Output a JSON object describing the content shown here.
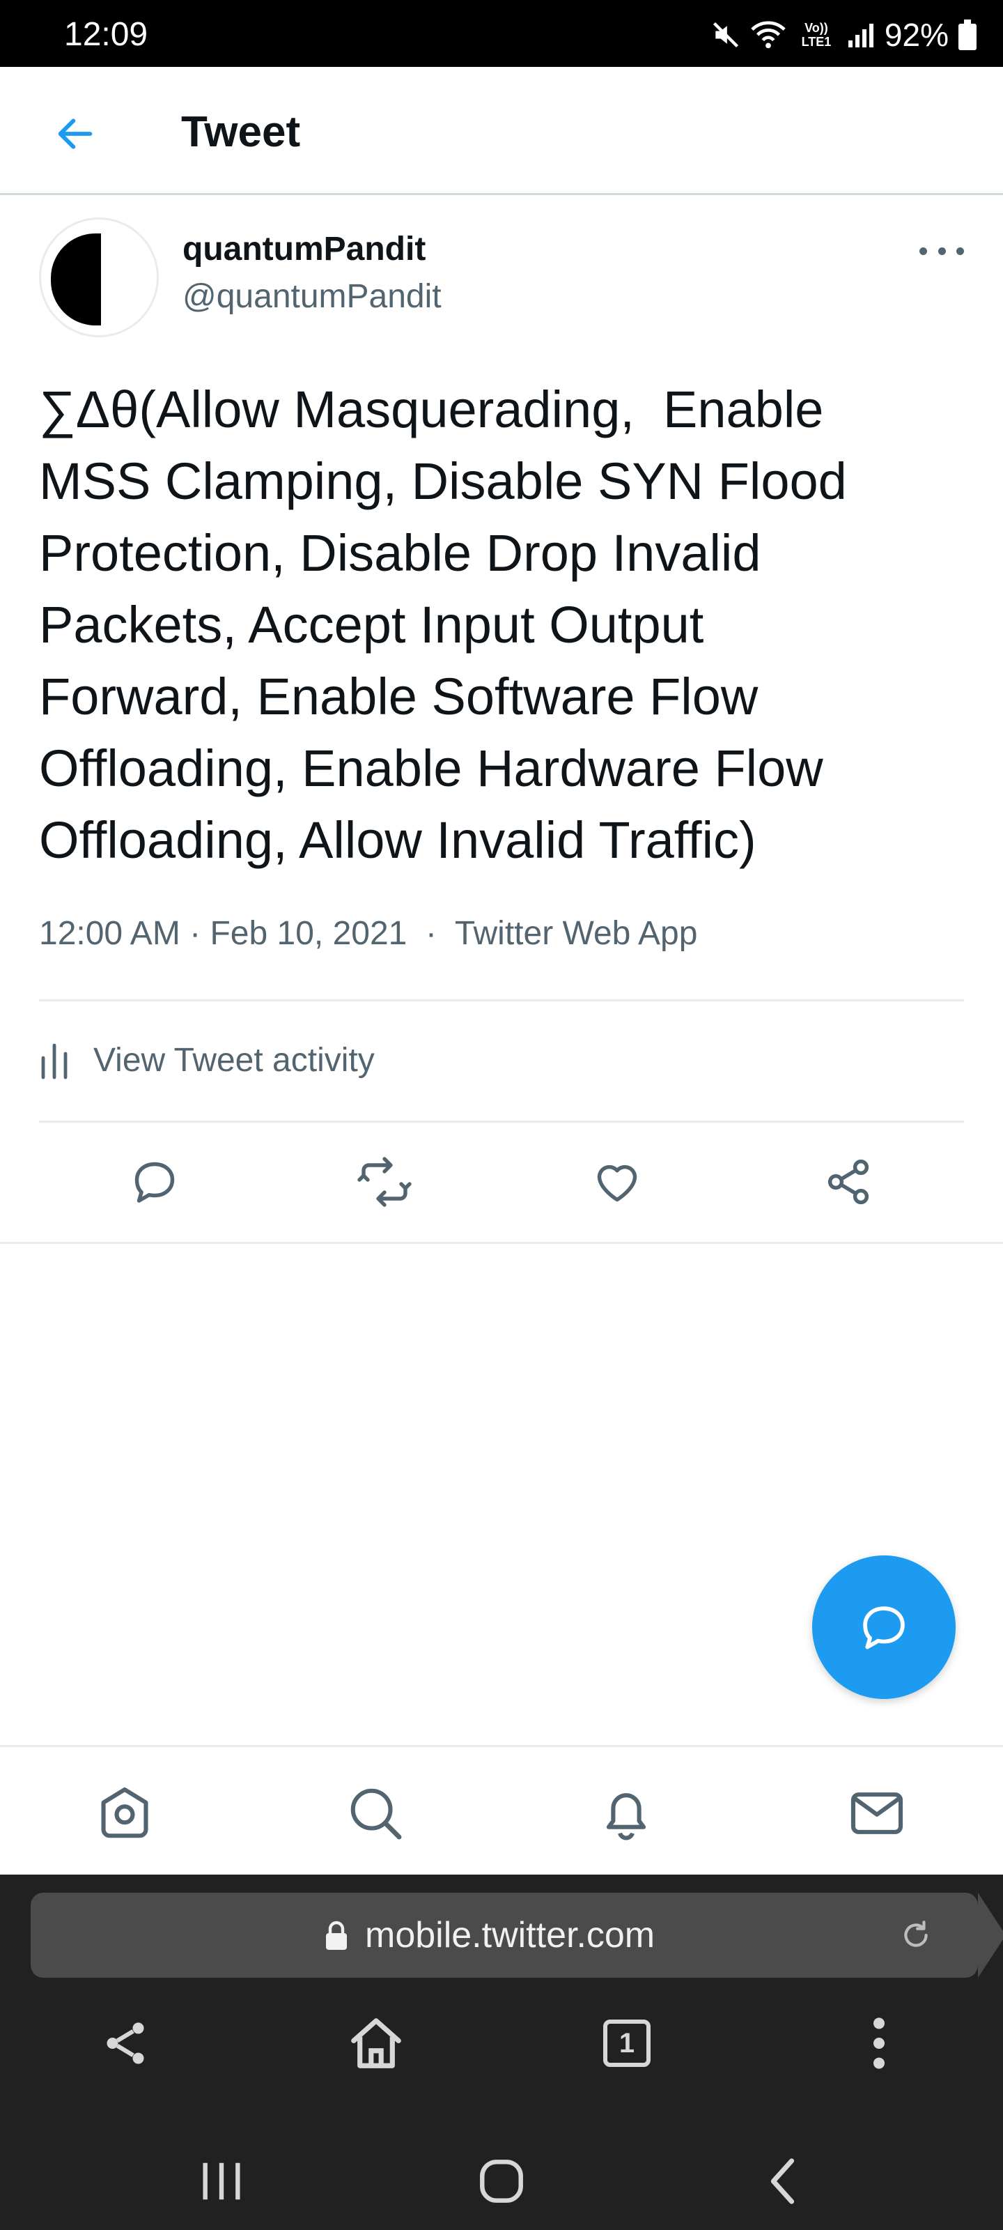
{
  "status_bar": {
    "time": "12:09",
    "network_label": "Vo)) LTE1",
    "battery": "92%",
    "icons": [
      "mute-icon",
      "wifi-icon",
      "signal-icon",
      "battery-icon"
    ]
  },
  "header": {
    "title": "Tweet",
    "back_icon": "arrow-left-icon"
  },
  "tweet": {
    "display_name": "quantumPandit",
    "username": "@quantumPandit",
    "text": "∑Δθ(Allow Masquerading,  Enable\nMSS Clamping, Disable SYN Flood\nProtection, Disable Drop Invalid\nPackets, Accept Input Output\nForward, Enable Software Flow\nOffloading, Enable Hardware Flow\nOffloading, Allow Invalid Traffic)",
    "timestamp": "12:00 AM · Feb 10, 2021",
    "source": "Twitter Web App",
    "activity_label": "View Tweet activity",
    "actions": [
      "reply-icon",
      "retweet-icon",
      "like-icon",
      "share-icon"
    ]
  },
  "bottom_nav": {
    "items": [
      "home-icon",
      "search-icon",
      "notifications-icon",
      "messages-icon"
    ]
  },
  "browser": {
    "url": "mobile.twitter.com",
    "tab_count": "1"
  },
  "colors": {
    "accent": "#1d9bf0",
    "secondary_text": "#536471",
    "divider": "#e6ecf0",
    "browser_bg": "#212121"
  }
}
